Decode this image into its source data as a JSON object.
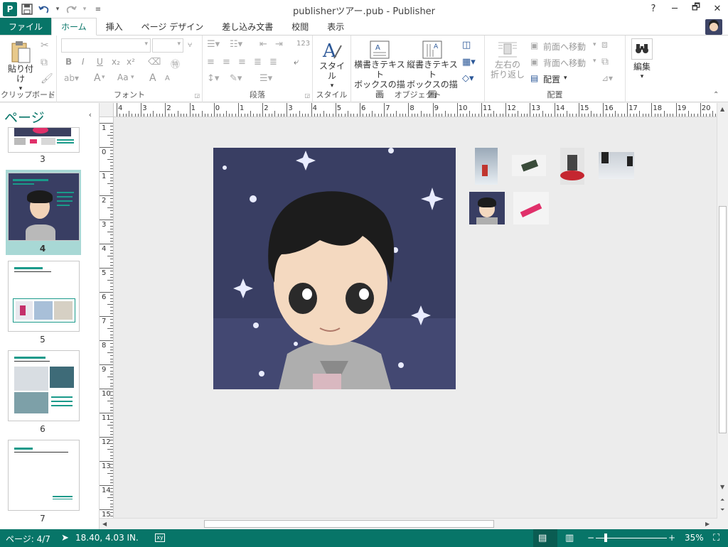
{
  "window": {
    "title": "publisherツアー.pub - Publisher",
    "help": "?",
    "restore": "🗗",
    "minimize": "─",
    "close": "✕",
    "app_letter": "P"
  },
  "qat": {
    "save": "💾",
    "undo": "↶",
    "redo": "↷",
    "customize": "▾"
  },
  "tabs": [
    "ファイル",
    "ホーム",
    "挿入",
    "ページ デザイン",
    "差し込み文書",
    "校閲",
    "表示"
  ],
  "ribbon": {
    "clipboard": {
      "paste": "貼り付け",
      "label": "クリップボード"
    },
    "font": {
      "label": "フォント",
      "bold": "B",
      "italic": "I",
      "underline": "U",
      "subscript": "x₂",
      "superscript": "x²",
      "grow": "A",
      "shrink": "A",
      "case": "Aa"
    },
    "paragraph": {
      "label": "段落",
      "numbering": "123"
    },
    "style": {
      "button": "スタイル",
      "label": "スタイル"
    },
    "objects": {
      "hbox": "横書きテキスト\nボックスの描画",
      "hbox_l1": "横書きテキスト",
      "hbox_l2": "ボックスの描画",
      "vbox_l1": "縦書きテキスト",
      "vbox_l2": "ボックスの描画",
      "label": "オブジェクト"
    },
    "arrange": {
      "wrap_l1": "左右の",
      "wrap_l2": "折り返し",
      "forward": "前面へ移動",
      "backward": "背面へ移動",
      "align": "配置",
      "label": "配置"
    },
    "edit": {
      "button": "編集"
    }
  },
  "pages_pane": {
    "title": "ページ",
    "collapse": "‹",
    "pages": [
      {
        "num": "3"
      },
      {
        "num": "4",
        "selected": true
      },
      {
        "num": "5"
      },
      {
        "num": "6"
      },
      {
        "num": "7"
      }
    ]
  },
  "ruler": {
    "h_labels": [
      "4",
      "3",
      "2",
      "1",
      "0",
      "1",
      "2",
      "3",
      "4",
      "5",
      "6",
      "7",
      "8",
      "9",
      "10",
      "11",
      "12",
      "13",
      "14",
      "15",
      "16",
      "17",
      "18",
      "19",
      "20"
    ],
    "v_labels": [
      "1",
      "0",
      "1",
      "2",
      "3",
      "4",
      "5",
      "6",
      "7",
      "8",
      "9",
      "10",
      "11",
      "12",
      "13",
      "14",
      "15"
    ]
  },
  "status": {
    "page": "ページ: 4/7",
    "position": "18.40, 4.03 IN.",
    "zoom": "35%",
    "zoom_minus": "−",
    "zoom_plus": "+"
  }
}
